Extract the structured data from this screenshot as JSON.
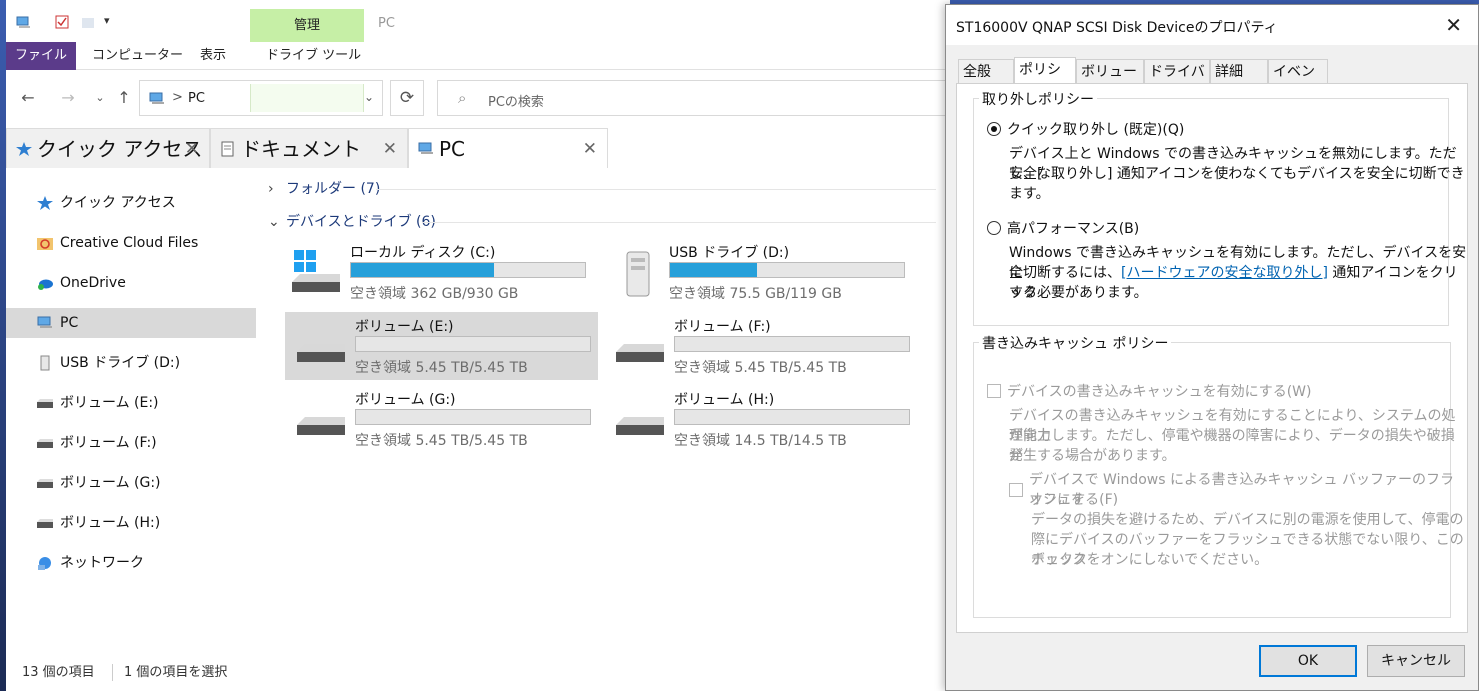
{
  "explorer": {
    "title": "PC",
    "ribbon": {
      "file": "ファイル",
      "computer": "コンピューター",
      "view": "表示",
      "manage_header": "管理",
      "drive_tools": "ドライブ ツール"
    },
    "address": {
      "path": "PC",
      "separator": ">"
    },
    "search": {
      "placeholder": "PCの検索"
    },
    "tabs": [
      {
        "label": "クイック アクセス"
      },
      {
        "label": "ドキュメント"
      },
      {
        "label": "PC"
      }
    ],
    "sidebar": [
      {
        "label": "クイック アクセス",
        "icon": "star-icon"
      },
      {
        "label": "Creative Cloud Files",
        "icon": "creative-cloud-icon"
      },
      {
        "label": "OneDrive",
        "icon": "onedrive-icon"
      },
      {
        "label": "PC",
        "icon": "pc-icon"
      },
      {
        "label": "USB ドライブ (D:)",
        "icon": "usb-drive-icon"
      },
      {
        "label": "ボリューム (E:)",
        "icon": "drive-icon"
      },
      {
        "label": "ボリューム (F:)",
        "icon": "drive-icon"
      },
      {
        "label": "ボリューム (G:)",
        "icon": "drive-icon"
      },
      {
        "label": "ボリューム (H:)",
        "icon": "drive-icon"
      },
      {
        "label": "ネットワーク",
        "icon": "network-icon"
      }
    ],
    "groups": {
      "folders": "フォルダー (7)",
      "devices": "デバイスとドライブ (6)"
    },
    "drives": [
      {
        "name": "ローカル ディスク (C:)",
        "free": "空き領域 362 GB/930 GB",
        "used_fraction": 0.61
      },
      {
        "name": "USB ドライブ (D:)",
        "free": "空き領域 75.5 GB/119 GB",
        "used_fraction": 0.37
      },
      {
        "name": "ボリューム (E:)",
        "free": "空き領域 5.45 TB/5.45 TB",
        "used_fraction": 0.0
      },
      {
        "name": "ボリューム (F:)",
        "free": "空き領域 5.45 TB/5.45 TB",
        "used_fraction": 0.0
      },
      {
        "name": "ボリューム (G:)",
        "free": "空き領域 5.45 TB/5.45 TB",
        "used_fraction": 0.0
      },
      {
        "name": "ボリューム (H:)",
        "free": "空き領域 14.5 TB/14.5 TB",
        "used_fraction": 0.0
      }
    ],
    "status": {
      "count": "13 個の項目",
      "selected": "1 個の項目を選択"
    }
  },
  "dialog": {
    "title": "ST16000V QNAP SCSI Disk Deviceのプロパティ",
    "tabs": [
      "全般",
      "ポリシー",
      "ボリューム",
      "ドライバー",
      "詳細",
      "イベント"
    ],
    "removal_policy": {
      "legend": "取り外しポリシー",
      "quick_label": "クイック取り外し (既定)(Q)",
      "quick_desc1": "デバイス上と Windows での書き込みキャッシュを無効にします。ただし、[",
      "quick_desc2": "安全な取り外し] 通知アイコンを使わなくてもデバイスを安全に切断でき",
      "quick_desc3": "ます。",
      "perf_label": "高パフォーマンス(B)",
      "perf_desc1": "Windows で書き込みキャッシュを有効にします。ただし、デバイスを安全",
      "perf_desc2_pre": "に切断するには、",
      "perf_desc2_link": "[ハードウェアの安全な取り外し]",
      "perf_desc2_post": " 通知アイコンをクリック",
      "perf_desc3": "する必要があります。"
    },
    "write_cache": {
      "legend": "書き込みキャッシュ ポリシー",
      "enable_label": "デバイスの書き込みキャッシュを有効にする(W)",
      "enable_desc1": "デバイスの書き込みキャッシュを有効にすることにより、システムの処理能力",
      "enable_desc2": "が向上します。ただし、停電や機器の障害により、データの損失や破損が",
      "enable_desc3": "発生する場合があります。",
      "flush_label1": "デバイスで Windows による書き込みキャッシュ バッファーのフラッシュを",
      "flush_label2": "オフにする(F)",
      "flush_desc1": "データの損失を避けるため、デバイスに別の電源を使用して、停電の",
      "flush_desc2": "際にデバイスのバッファーをフラッシュできる状態でない限り、このチェック",
      "flush_desc3": "ボックスをオンにしないでください。"
    },
    "buttons": {
      "ok": "OK",
      "cancel": "キャンセル"
    }
  }
}
